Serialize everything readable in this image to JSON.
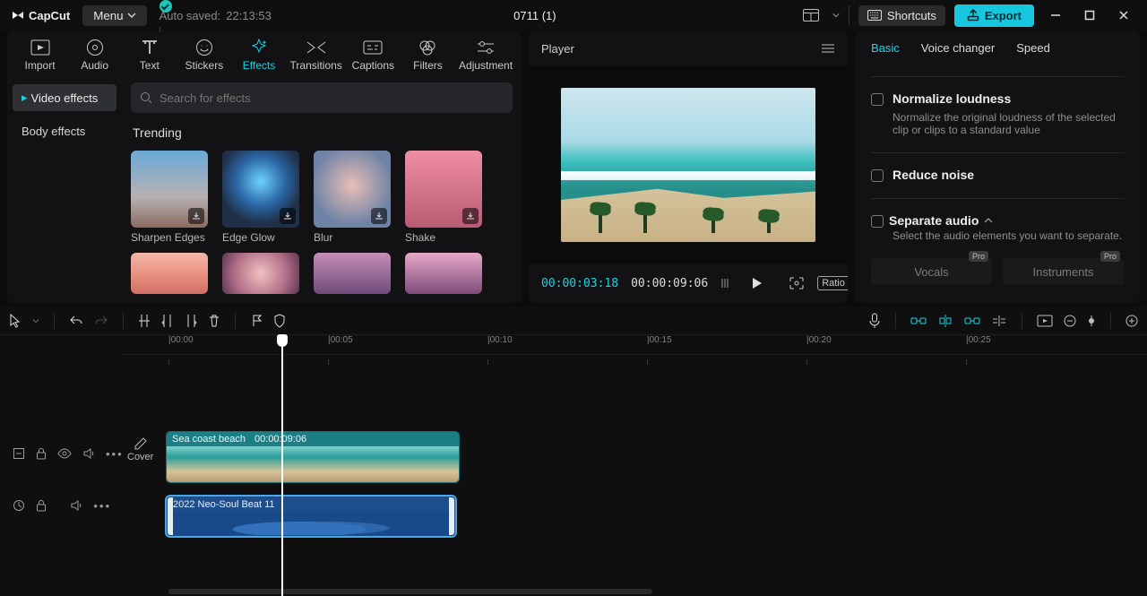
{
  "app": {
    "name": "CapCut"
  },
  "topbar": {
    "menu_label": "Menu",
    "autosave_prefix": "Auto saved:",
    "autosave_time": "22:13:53",
    "project_title": "0711 (1)",
    "shortcuts_label": "Shortcuts",
    "export_label": "Export"
  },
  "media_tabs": {
    "items": [
      "Import",
      "Audio",
      "Text",
      "Stickers",
      "Effects",
      "Transitions",
      "Captions",
      "Filters",
      "Adjustment"
    ],
    "active": "Effects"
  },
  "effects_panel": {
    "side_items": [
      {
        "label": "Video effects",
        "active": true,
        "has_marker": true
      },
      {
        "label": "Body effects",
        "active": false,
        "has_marker": false
      }
    ],
    "search_placeholder": "Search for effects",
    "section_title": "Trending",
    "effects": [
      {
        "label": "Sharpen Edges"
      },
      {
        "label": "Edge Glow"
      },
      {
        "label": "Blur"
      },
      {
        "label": "Shake"
      }
    ]
  },
  "player": {
    "header": "Player",
    "current_time": "00:00:03:18",
    "total_time": "00:00:09:06",
    "ratio_label": "Ratio"
  },
  "inspector": {
    "tabs": [
      "Basic",
      "Voice changer",
      "Speed"
    ],
    "active": "Basic",
    "normalize_title": "Normalize loudness",
    "normalize_desc": "Normalize the original loudness of the selected clip or clips to a standard value",
    "reduce_title": "Reduce noise",
    "separate_title": "Separate audio",
    "separate_desc": "Select the audio elements you want to separate.",
    "sep_a": "Vocals",
    "sep_b": "Instruments",
    "pro_badge": "Pro"
  },
  "timeline": {
    "ruler": [
      "00:00",
      "00:05",
      "00:10",
      "00:15",
      "00:20",
      "00:25"
    ],
    "cover_label": "Cover",
    "video_clip": {
      "name": "Sea coast beach",
      "duration": "00:00:09:06"
    },
    "audio_clip": {
      "name": "2022 Neo-Soul Beat 11"
    }
  }
}
